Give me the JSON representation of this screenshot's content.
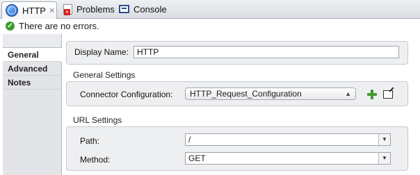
{
  "tabs": [
    {
      "label": "HTTP",
      "icon": "globe-icon",
      "active": true,
      "closable": true
    },
    {
      "label": "Problems",
      "icon": "problems-icon",
      "active": false
    },
    {
      "label": "Console",
      "icon": "console-icon",
      "active": false
    }
  ],
  "status": {
    "message": "There are no errors.",
    "icon": "check-circle-icon",
    "color": "#3d9b2c"
  },
  "leftnav": {
    "items": [
      {
        "label": "General",
        "active": true
      },
      {
        "label": "Advanced",
        "active": false
      },
      {
        "label": "Notes",
        "active": false
      }
    ]
  },
  "general": {
    "display_name_label": "Display Name:",
    "display_name_value": "HTTP",
    "settings_title": "General Settings",
    "connector_label": "Connector Configuration:",
    "connector_value": "HTTP_Request_Configuration"
  },
  "url": {
    "title": "URL Settings",
    "path_label": "Path:",
    "path_value": "/",
    "method_label": "Method:",
    "method_value": "GET"
  }
}
